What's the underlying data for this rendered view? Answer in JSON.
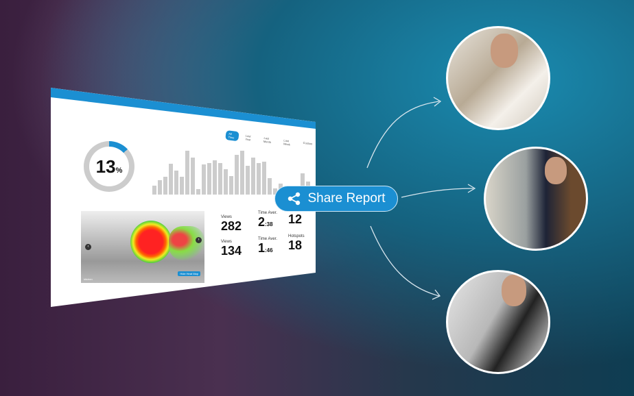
{
  "dashboard": {
    "tabs": [
      "All Time",
      "Last Year",
      "Last Month",
      "Last Week",
      "Custom"
    ],
    "percent": {
      "value": "13",
      "unit": "%",
      "fraction": 0.13
    },
    "accent": "#1b8fd2",
    "panorama": {
      "label": "kitchen",
      "heatmap_button": "Hide Heat Map"
    },
    "stats": [
      {
        "label": "Views",
        "value": "282"
      },
      {
        "label": "Time Aver.",
        "value": "2",
        "suffix": ":38"
      },
      {
        "label": "",
        "value": "12"
      },
      {
        "label": "Views",
        "value": "134"
      },
      {
        "label": "Time Aver.",
        "value": "1",
        "suffix": ":46"
      },
      {
        "label": "Hotspots",
        "value": "18"
      }
    ]
  },
  "chart_data": {
    "type": "bar",
    "values": [
      20,
      33,
      40,
      70,
      55,
      40,
      100,
      85,
      12,
      68,
      72,
      78,
      72,
      58,
      42,
      90,
      100,
      66,
      85,
      72,
      75,
      38,
      14,
      25,
      14,
      20,
      18,
      48,
      30
    ]
  },
  "share": {
    "label": "Share Report",
    "icon": "share-icon"
  },
  "recipients": [
    {
      "device": "phone"
    },
    {
      "device": "laptop"
    },
    {
      "device": "tablet"
    }
  ]
}
